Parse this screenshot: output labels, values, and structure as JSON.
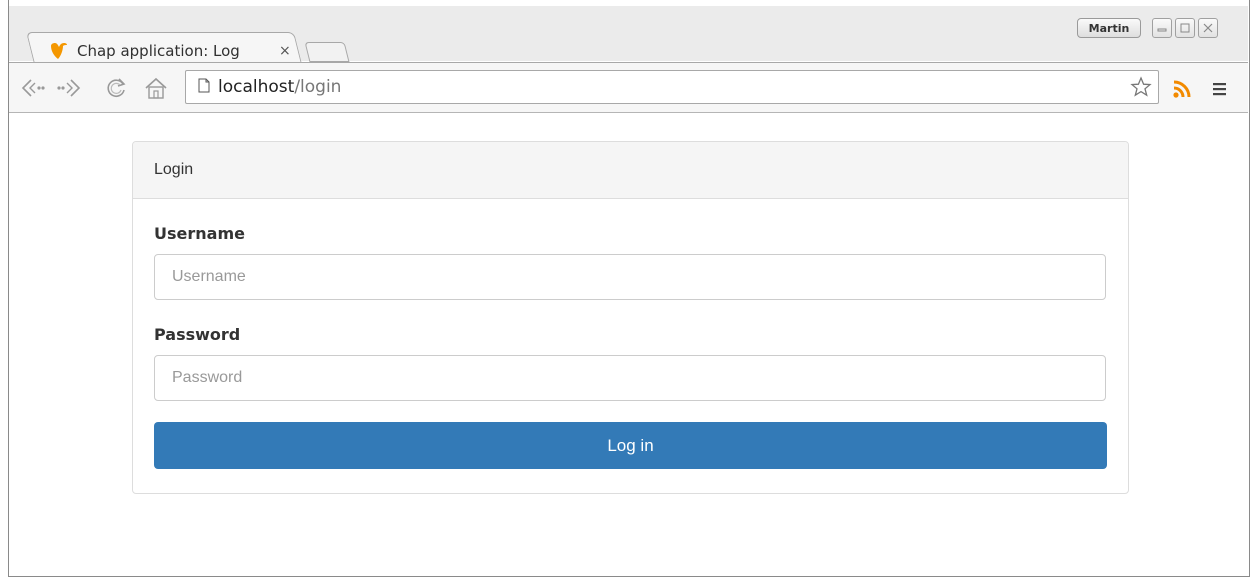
{
  "browser": {
    "tab_title": "Chap application: Log",
    "tab_close_glyph": "×",
    "profile_name": "Martin",
    "url_host": "localhost",
    "url_path": "/login",
    "icons": [
      "typo3-logo-icon",
      "back-icon",
      "forward-icon",
      "reload-icon",
      "home-icon",
      "page-icon",
      "star-icon",
      "rss-icon",
      "menu-icon",
      "minimize-icon",
      "maximize-icon",
      "close-icon"
    ],
    "colors": {
      "favicon": "#f49700",
      "rss": "#f28a00"
    }
  },
  "login": {
    "heading": "Login",
    "username_label": "Username",
    "username_placeholder": "Username",
    "password_label": "Password",
    "password_placeholder": "Password",
    "submit_label": "Log in",
    "colors": {
      "button": "#337ab7"
    }
  }
}
